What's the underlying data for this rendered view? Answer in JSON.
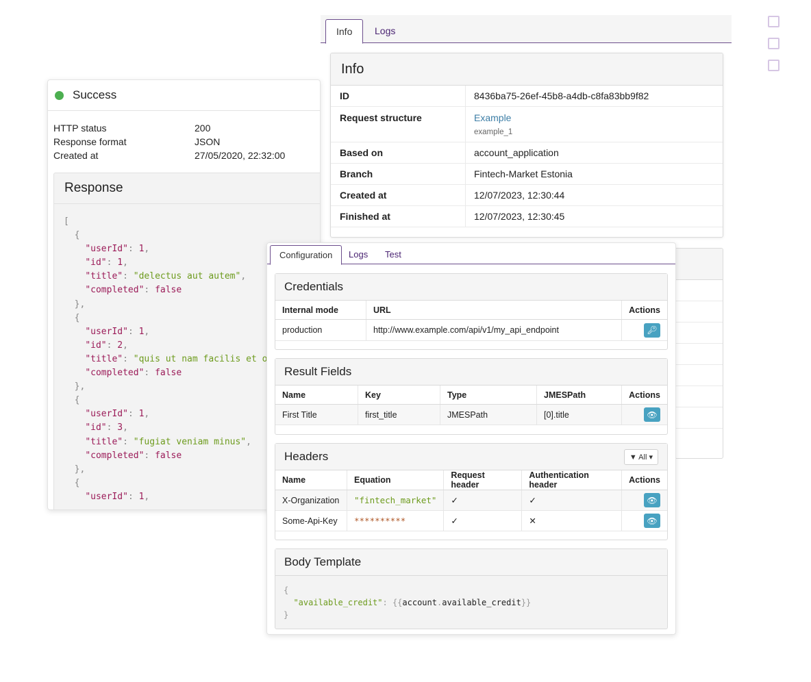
{
  "success": {
    "status_title": "Success",
    "fields": [
      {
        "label": "HTTP status",
        "value": "200"
      },
      {
        "label": "Response format",
        "value": "JSON"
      },
      {
        "label": "Created at",
        "value": "27/05/2020, 22:32:00"
      }
    ],
    "response_title": "Response",
    "response_items": [
      {
        "userId": "1",
        "id": "1",
        "title": "\"delectus aut autem\"",
        "completed": "false"
      },
      {
        "userId": "1",
        "id": "2",
        "title": "\"quis ut nam facilis et offic",
        "completed": "false"
      },
      {
        "userId": "1",
        "id": "3",
        "title": "\"fugiat veniam minus\"",
        "completed": "false"
      }
    ],
    "response_last_user": "1"
  },
  "info_tabs": [
    "Info",
    "Logs"
  ],
  "info": {
    "title": "Info",
    "rows": [
      {
        "label": "ID",
        "value": "8436ba75-26ef-45b8-a4db-c8fa83bb9f82"
      },
      {
        "label": "Request structure",
        "value": "Example",
        "sub": "example_1"
      },
      {
        "label": "Based on",
        "value": "account_application"
      },
      {
        "label": "Branch",
        "value": "Fintech-Market Estonia"
      },
      {
        "label": "Created at",
        "value": "12/07/2023, 12:30:44"
      },
      {
        "label": "Finished at",
        "value": "12/07/2023, 12:30:45"
      }
    ]
  },
  "config": {
    "tabs": [
      "Configuration",
      "Logs",
      "Test"
    ],
    "credentials": {
      "title": "Credentials",
      "headers": [
        "Internal mode",
        "URL",
        "Actions"
      ],
      "rows": [
        [
          "production",
          "http://www.example.com/api/v1/my_api_endpoint"
        ]
      ]
    },
    "result_fields": {
      "title": "Result Fields",
      "headers": [
        "Name",
        "Key",
        "Type",
        "JMESPath",
        "Actions"
      ],
      "rows": [
        [
          "First Title",
          "first_title",
          "JMESPath",
          "[0].title"
        ]
      ]
    },
    "headers_section": {
      "title": "Headers",
      "filter_label": "All",
      "headers": [
        "Name",
        "Equation",
        "Request header",
        "Authentication header",
        "Actions"
      ],
      "rows": [
        [
          "X-Organization",
          "\"fintech_market\"",
          "✓",
          "✓"
        ],
        [
          "Some-Api-Key",
          "**********",
          "✓",
          "✕"
        ]
      ]
    },
    "body_template": {
      "title": "Body Template",
      "key": "\"available_credit\"",
      "value_obj": "account",
      "value_field": "available_credit"
    }
  },
  "colors": {
    "accent": "#6b4d8c",
    "success": "#4caf50",
    "action": "#48a2c1",
    "link": "#3d7ea6"
  }
}
